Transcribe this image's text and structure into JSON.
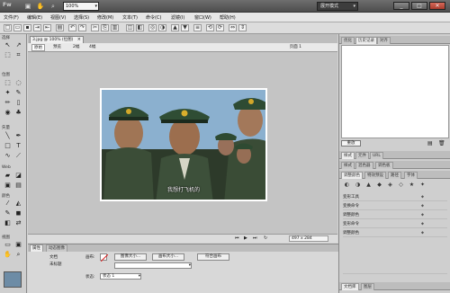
{
  "titlebar": {
    "logo": "Fw",
    "zoom": "100%",
    "workspace": "展开模式",
    "controls": [
      "_",
      "□",
      "✕"
    ]
  },
  "menu": [
    "文件(F)",
    "编辑(E)",
    "视图(V)",
    "选择(S)",
    "修改(M)",
    "文本(T)",
    "命令(C)",
    "滤镜(I)",
    "窗口(W)",
    "帮助(H)"
  ],
  "document": {
    "tab_title": "3.jpg @ 100% (位图)",
    "edit_buttons": [
      "原始",
      "预览",
      "2幅",
      "4幅"
    ],
    "page": "页面 1",
    "subtitle": "我想打飞机的",
    "size": "497 x 284"
  },
  "tools": {
    "sections": [
      "选择",
      "位图",
      "矢量",
      "Web",
      "颜色",
      "视图"
    ]
  },
  "right_panel": {
    "top_tabs": [
      "优化",
      "历史记录",
      "对齐"
    ],
    "history_button": "重放",
    "mid_tabs": [
      "样式",
      "元件",
      "URL"
    ],
    "mid_tabs2": [
      "样式",
      "混色器",
      "调色板"
    ],
    "preset_tabs": [
      "调整颜色",
      "特效预设",
      "路径",
      "字体"
    ],
    "rows": [
      "变形工具",
      "变换命令",
      "调整颜色",
      "变形命令",
      "调整颜色"
    ],
    "bottom_tabs": [
      "文档库",
      "图层"
    ]
  },
  "props": {
    "tabs": [
      "属性",
      "动态图像"
    ],
    "doc_label": "文档",
    "doc_type": "未标题",
    "canvas_label": "画布:",
    "canvas_size_btn": "图像大小...",
    "image_size_btn": "画布大小...",
    "fit_btn": "符合画布",
    "state_label": "状态:",
    "state_value": "状态 1"
  },
  "colors": {
    "accent": "#3d6ea8",
    "photo_bg": "#7fa6c7"
  }
}
